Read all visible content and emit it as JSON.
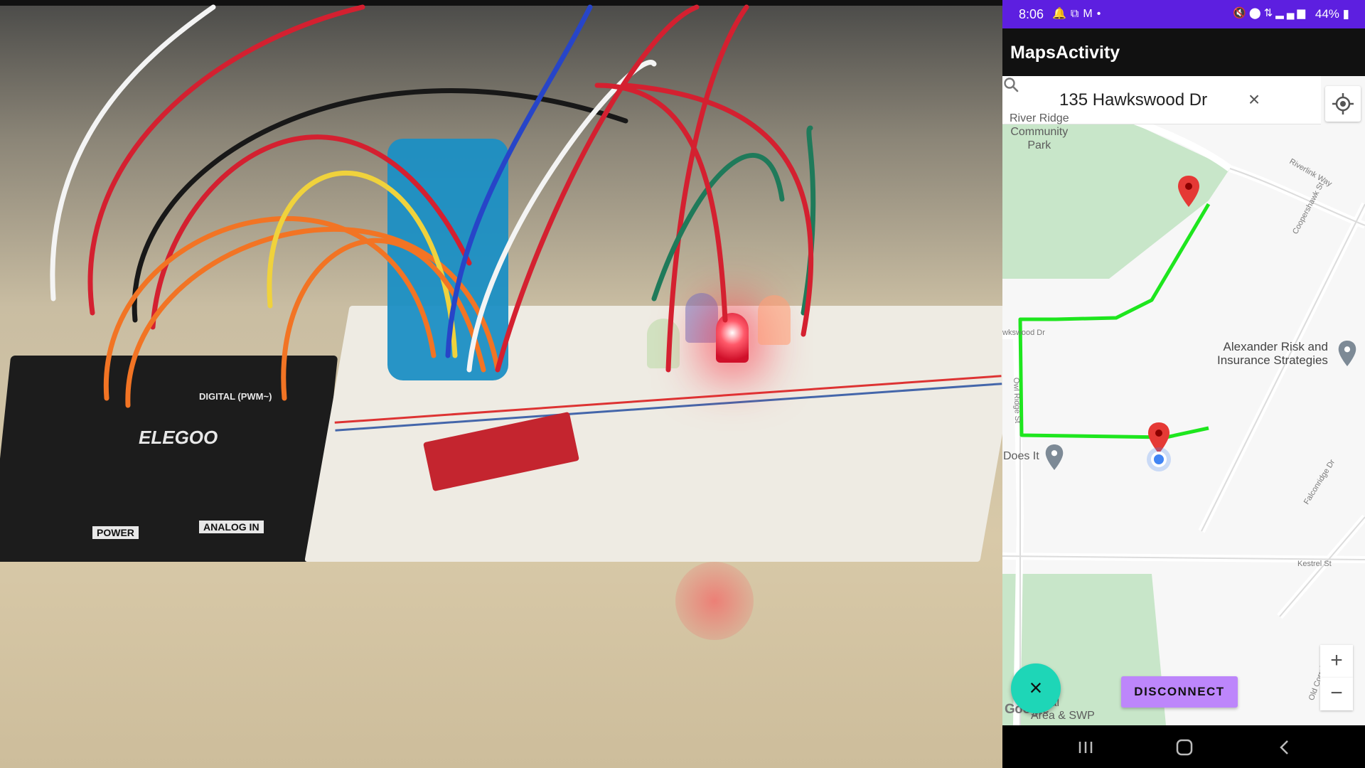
{
  "status_bar": {
    "time": "8:06",
    "left_icons": [
      "bell-icon",
      "screenshot-icon",
      "gmail-icon",
      "dot-icon"
    ],
    "right_icons": [
      "mute-icon",
      "location-icon",
      "lte-icon",
      "signal-icon"
    ],
    "battery": "44%"
  },
  "app_bar": {
    "title": "MapsActivity"
  },
  "search": {
    "value": "135 Hawkswood Dr"
  },
  "map": {
    "poi_park": "River Ridge\nCommunity\nPark",
    "poi_business": "Alexander Risk and\nInsurance Strategies",
    "poi_does_it": "Does It",
    "poi_bottom": "ige\natural\nArea & SWP",
    "streets": {
      "riverlink": "Riverlink Way",
      "coopershawk": "Coopershawk St",
      "hawkswood": "wkswood Dr",
      "owlridge": "Owl Ridge St",
      "falconridge": "Falconridge Dr",
      "kestrel": "Kestrel St",
      "old_corral": "Old Corral"
    },
    "route_color": "#1ee61e",
    "pin_color": "#e53935",
    "google_label": "Google"
  },
  "controls": {
    "zoom_in": "+",
    "zoom_out": "−",
    "fab_icon": "×",
    "disconnect_label": "DISCONNECT",
    "clear_icon": "×"
  },
  "nav_bar": {
    "recents": "|||",
    "home": "○",
    "back": "‹"
  },
  "video": {
    "board_brand": "ELEGOO",
    "board_power": "POWER",
    "board_analog": "ANALOG IN",
    "board_digital": "DIGITAL (PWM~)"
  }
}
